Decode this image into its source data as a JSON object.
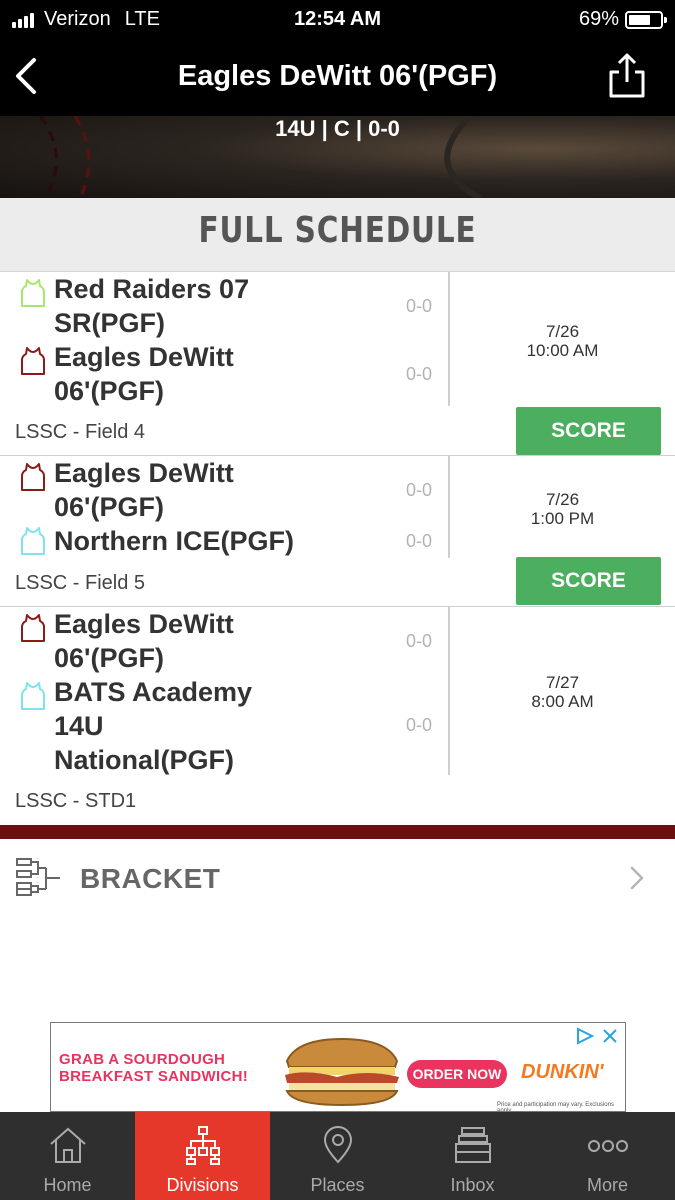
{
  "status_bar": {
    "carrier": "Verizon",
    "network": "LTE",
    "time": "12:54 AM",
    "battery": "69%",
    "battery_level": 0.69
  },
  "header": {
    "title": "Eagles DeWitt 06'(PGF)",
    "subtitle": "14U | C | 0-0"
  },
  "section": {
    "title": "FULL SCHEDULE"
  },
  "colors": {
    "jersey_green": "#a6e86a",
    "jersey_maroon": "#8b1a1a",
    "jersey_cyan": "#7fe3ec",
    "score_button": "#4caf5f",
    "active_tab": "#e5382a"
  },
  "games": [
    {
      "team1": {
        "name": "Red Raiders 07 SR(PGF)",
        "score": "0-0",
        "jersey": "green-jersey-icon"
      },
      "team2": {
        "name": "Eagles DeWitt 06'(PGF)",
        "score": "0-0",
        "jersey": "maroon-jersey-icon"
      },
      "date": "7/26",
      "time": "10:00 AM",
      "location": "LSSC - Field 4",
      "button": "SCORE"
    },
    {
      "team1": {
        "name": "Eagles DeWitt 06'(PGF)",
        "score": "0-0",
        "jersey": "maroon-jersey-icon"
      },
      "team2": {
        "name": "Northern ICE(PGF)",
        "score": "0-0",
        "jersey": "cyan-jersey-icon"
      },
      "date": "7/26",
      "time": "1:00 PM",
      "location": "LSSC - Field 5",
      "button": "SCORE"
    },
    {
      "team1": {
        "name": "Eagles DeWitt 06'(PGF)",
        "score": "0-0",
        "jersey": "maroon-jersey-icon"
      },
      "team2": {
        "name": "BATS Academy 14U National(PGF)",
        "score": "0-0",
        "jersey": "cyan-jersey-icon"
      },
      "date": "7/27",
      "time": "8:00 AM",
      "location": "LSSC - STD1"
    }
  ],
  "bracket": {
    "label": "BRACKET"
  },
  "ad": {
    "headline_line1": "GRAB A SOURDOUGH",
    "headline_line2": "BREAKFAST SANDWICH!",
    "cta": "ORDER NOW",
    "brand": "DUNKIN'",
    "disclaimer": "Price and participation may vary. Exclusions apply."
  },
  "tabs": [
    {
      "label": "Home",
      "icon": "home-icon"
    },
    {
      "label": "Divisions",
      "icon": "divisions-icon",
      "active": true
    },
    {
      "label": "Places",
      "icon": "location-pin-icon"
    },
    {
      "label": "Inbox",
      "icon": "inbox-icon"
    },
    {
      "label": "More",
      "icon": "more-dots-icon"
    }
  ]
}
